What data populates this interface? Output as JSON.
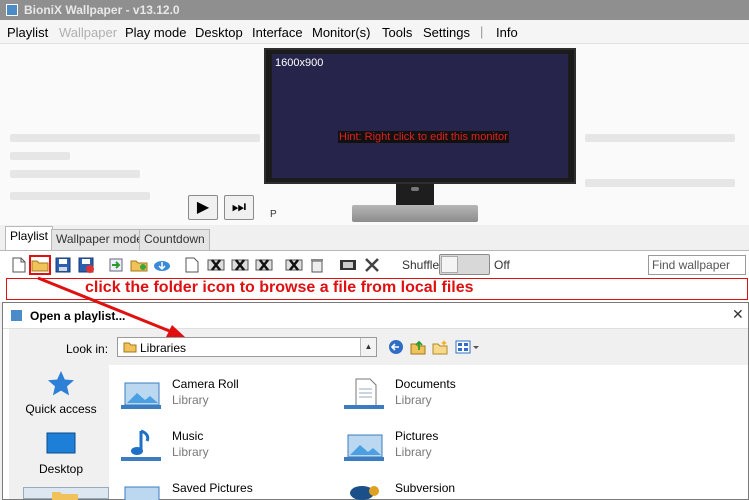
{
  "window": {
    "title": "BioniX Wallpaper - v13.12.0"
  },
  "menu": {
    "items": [
      {
        "label": "Playlist",
        "enabled": true
      },
      {
        "label": "Wallpaper",
        "enabled": false
      },
      {
        "label": "Play mode",
        "enabled": true
      },
      {
        "label": "Desktop",
        "enabled": true
      },
      {
        "label": "Interface",
        "enabled": true
      },
      {
        "label": "Monitor(s)",
        "enabled": true
      },
      {
        "label": "Tools",
        "enabled": true
      },
      {
        "label": "Settings",
        "enabled": true
      },
      {
        "label": "Info",
        "enabled": true
      }
    ],
    "separator": "|"
  },
  "monitor": {
    "resolution": "1600x900",
    "hint": "Hint: Right click to edit this monitor"
  },
  "player": {
    "play_glyph": "▶",
    "next_glyph": "⏭",
    "label": "P"
  },
  "tabs": [
    {
      "label": "Playlist",
      "active": true
    },
    {
      "label": "Wallpaper mode",
      "active": false
    },
    {
      "label": "Countdown",
      "active": false
    }
  ],
  "toolbar": {
    "icons": [
      "new-file-icon",
      "open-folder-icon",
      "save-icon",
      "save-as-icon",
      "import-icon",
      "add-folder-icon",
      "download-icon",
      "blank-page-icon",
      "remove-x-icon",
      "remove-x-all-icon",
      "remove-x-dup-icon",
      "delete-x-icon",
      "trash-icon",
      "film-icon",
      "tools-icon"
    ],
    "shuffle_label": "Shuffle",
    "shuffle_state": "Off",
    "find_placeholder": "Find wallpaper"
  },
  "annotation": {
    "text": "click the folder icon to browse a file from local files"
  },
  "dialog": {
    "title": "Open a playlist...",
    "close_glyph": "✕",
    "look_in_label": "Look in:",
    "look_in_value": "Libraries",
    "places": [
      {
        "label": "Quick access"
      },
      {
        "label": "Desktop"
      }
    ],
    "files": [
      {
        "name": "Camera Roll",
        "type": "Library"
      },
      {
        "name": "Documents",
        "type": "Library"
      },
      {
        "name": "Music",
        "type": "Library"
      },
      {
        "name": "Pictures",
        "type": "Library"
      },
      {
        "name": "Saved Pictures",
        "type": ""
      },
      {
        "name": "Subversion",
        "type": ""
      }
    ]
  },
  "colors": {
    "accent_red": "#e01010",
    "screen": "#26244a",
    "folder_yellow": "#f2c25a"
  }
}
